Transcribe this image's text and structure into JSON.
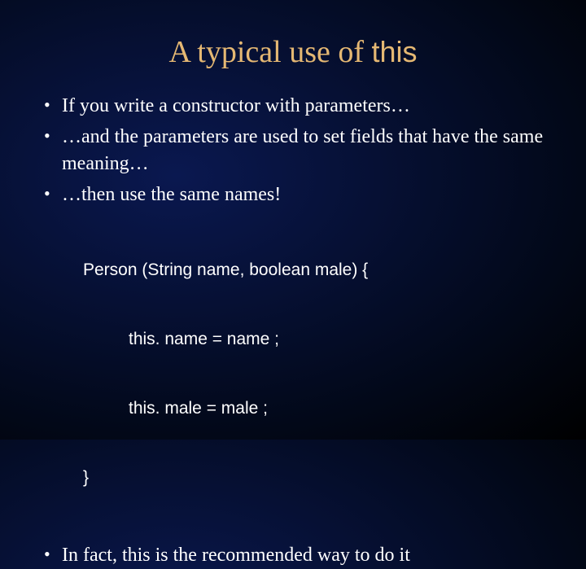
{
  "title": {
    "prefix": "A typical use of ",
    "code": "this"
  },
  "bullets": [
    "If you write a constructor with parameters…",
    "…and the parameters are used to set fields that have the same meaning…",
    "…then use the same names!"
  ],
  "code": {
    "line1": "Person (String name, boolean male) {",
    "line2": "this. name = name ;",
    "line3": "this. male = male ;",
    "line4": "}"
  },
  "bulletAfter": "In fact, this is the recommended way to do it"
}
